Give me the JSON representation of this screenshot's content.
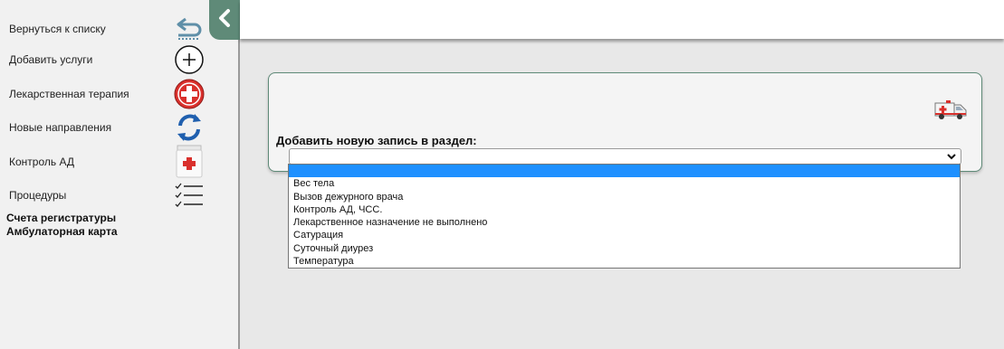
{
  "sidebar": {
    "items": [
      {
        "label": "Вернуться к списку",
        "icon": "return-arrow-icon"
      },
      {
        "label": "Добавить услуги",
        "icon": "plus-circle-icon"
      },
      {
        "label": "Лекарственная терапия",
        "icon": "medical-cross-icon"
      },
      {
        "label": "Новые направления",
        "icon": "refresh-arrows-icon"
      },
      {
        "label": "Контроль АД",
        "icon": "medicine-jar-icon"
      },
      {
        "label": "Процедуры",
        "icon": "checklist-icon"
      }
    ],
    "links": [
      "Счета регистратуры",
      "Амбулаторная карта"
    ],
    "collapse_icon": "chevron-left-icon"
  },
  "panel": {
    "label": "Добавить новую запись в раздел:",
    "icon": "ambulance-icon",
    "select": {
      "value": "",
      "options": [
        "",
        "Вес тела",
        "Вызов дежурного врача",
        "Контроль АД, ЧСС.",
        "Лекарственное назначение не выполнено",
        "Сатурация",
        "Суточный диурез",
        "Температура"
      ],
      "highlighted_index": 0
    }
  },
  "colors": {
    "accent": "#5f8a78",
    "highlight": "#1e90ff",
    "medical_red": "#d9302c",
    "sync_blue": "#1f5fae"
  }
}
